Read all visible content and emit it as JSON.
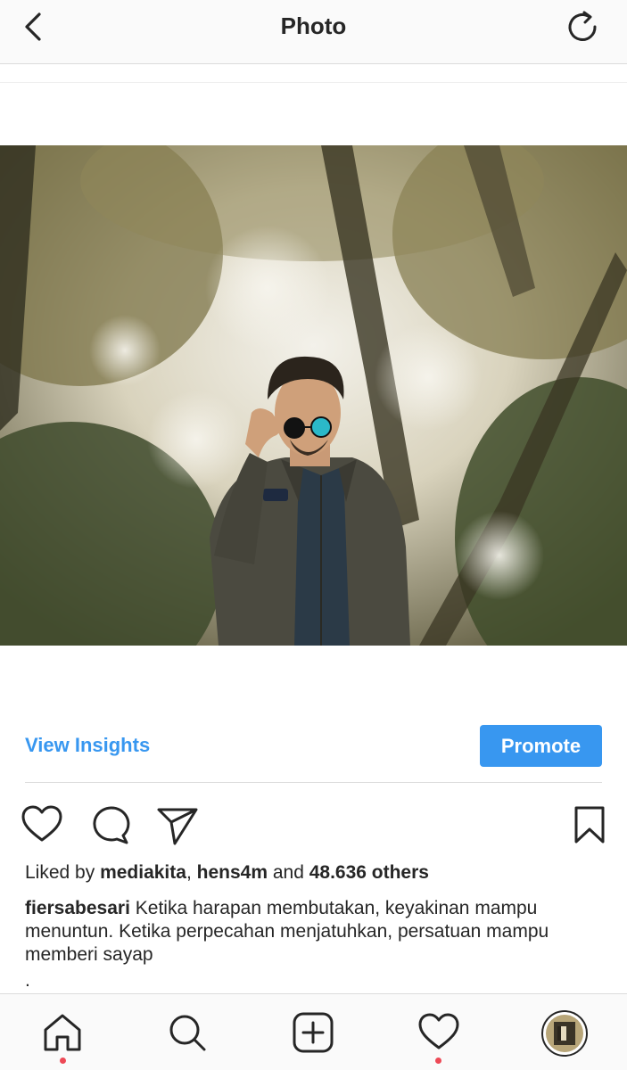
{
  "header": {
    "title": "Photo",
    "back_icon": "chevron-left-icon",
    "refresh_icon": "refresh-icon"
  },
  "post": {
    "image_description_icon": "post-photo",
    "view_insights_label": "View Insights",
    "promote_label": "Promote",
    "likes": {
      "prefix": "Liked by ",
      "user1": "mediakita",
      "sep": ", ",
      "user2": "hens4m",
      "and": " and ",
      "others": "48.636 others"
    },
    "caption": {
      "username": "fiersabesari",
      "text": " Ketika harapan membutakan, keyakinan mampu menuntun. Ketika perpecahan menjatuhkan, persatuan mampu memberi sayap"
    },
    "more_dot": "."
  },
  "colors": {
    "accent": "#3897f0",
    "notification": "#ed4956",
    "text": "#262626"
  }
}
